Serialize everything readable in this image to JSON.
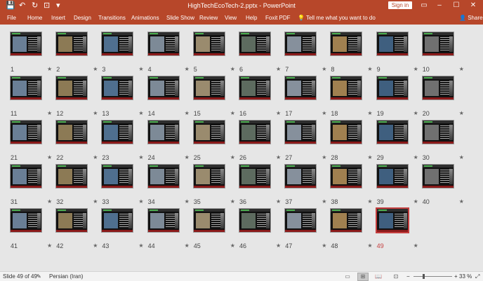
{
  "window": {
    "title": "HighTechEcoTech-2.pptx  -  PowerPoint",
    "sign_in": "Sign in",
    "qat": {
      "save": "💾",
      "undo": "↶",
      "redo": "↻",
      "present": "⊡",
      "customize": "▾"
    },
    "controls": {
      "ribbon_options": "▭",
      "minimize": "–",
      "maximize": "☐",
      "close": "✕"
    }
  },
  "ribbon": {
    "tabs": [
      "File",
      "Home",
      "Insert",
      "Design",
      "Transitions",
      "Animations",
      "Slide Show",
      "Review",
      "View",
      "Help",
      "Foxit PDF"
    ],
    "tell_me": "Tell me what you want to do",
    "tell_me_icon": "lightbulb-icon",
    "share": "Share"
  },
  "slides": {
    "numbers": [
      "1",
      "2",
      "3",
      "4",
      "5",
      "6",
      "7",
      "8",
      "9",
      "10",
      "11",
      "12",
      "13",
      "14",
      "15",
      "16",
      "17",
      "18",
      "19",
      "20",
      "21",
      "22",
      "23",
      "24",
      "25",
      "26",
      "27",
      "28",
      "29",
      "30",
      "31",
      "32",
      "33",
      "34",
      "35",
      "36",
      "37",
      "38",
      "39",
      "40",
      "41",
      "42",
      "43",
      "44",
      "45",
      "46",
      "47",
      "48",
      "49"
    ],
    "transition_marker": "★",
    "selected": 49,
    "colors": {
      "selected_border": "#c43e3e",
      "title_highlight": "#4caf50",
      "footer_bar": "#8b1a1a"
    }
  },
  "statusbar": {
    "slide_info": "Slide 49 of 49",
    "language": "Persian (Iran)",
    "zoom": "33 %",
    "zoom_minus": "−",
    "zoom_plus": "+",
    "fit": "⤢"
  },
  "colors": {
    "accent": "#b7472a",
    "background": "#e6e6e6"
  }
}
